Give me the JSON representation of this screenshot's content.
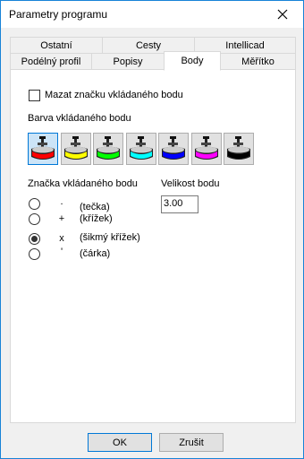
{
  "window": {
    "title": "Parametry programu"
  },
  "tabs_row1": [
    "Ostatní",
    "Cesty",
    "Intellicad"
  ],
  "tabs_row2": [
    "Podélný profil",
    "Popisy",
    "Body",
    "Měřítko"
  ],
  "active_tab": "Body",
  "panel": {
    "mazat_label": "Mazat značku vkládaného bodu",
    "mazat_checked": false,
    "barva_label": "Barva vkládaného bodu",
    "colors": [
      {
        "name": "red",
        "hex": "#ff0000",
        "selected": true
      },
      {
        "name": "yellow",
        "hex": "#ffff00",
        "selected": false
      },
      {
        "name": "green",
        "hex": "#00ff00",
        "selected": false
      },
      {
        "name": "cyan",
        "hex": "#00ffff",
        "selected": false
      },
      {
        "name": "blue",
        "hex": "#0000ff",
        "selected": false
      },
      {
        "name": "magenta",
        "hex": "#ff00ff",
        "selected": false
      },
      {
        "name": "black",
        "hex": "#000000",
        "selected": false
      }
    ],
    "znacka_label": "Značka vkládaného bodu",
    "velikost_label": "Velikost bodu",
    "velikost_value": "3.00",
    "marks": [
      {
        "symbol": ".",
        "label": "(tečka)",
        "checked": false
      },
      {
        "symbol": "+",
        "label": "(křížek)",
        "checked": false
      },
      {
        "symbol": "x",
        "label": "(šikmý křížek)",
        "checked": true
      },
      {
        "symbol": "'",
        "label": "(čárka)",
        "checked": false
      }
    ]
  },
  "buttons": {
    "ok": "OK",
    "cancel": "Zrušit"
  }
}
